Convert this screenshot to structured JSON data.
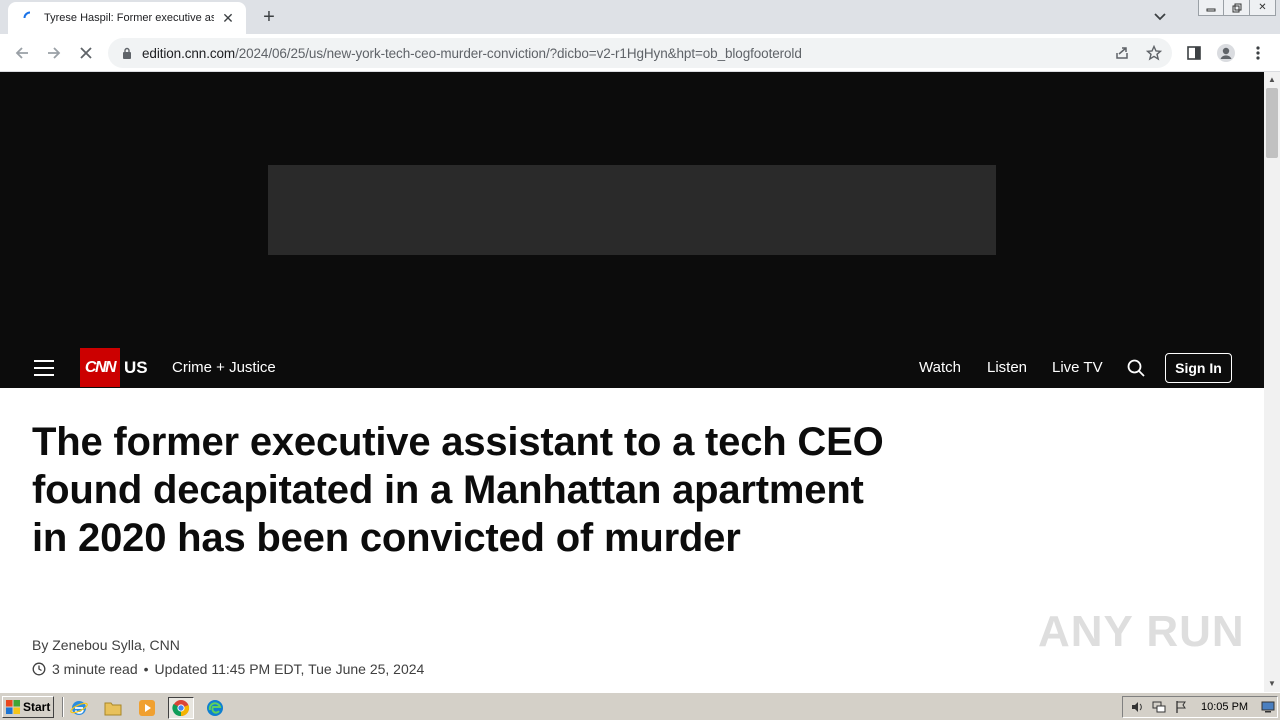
{
  "browser": {
    "tab_title": "Tyrese Haspil: Former executive assistant to a tech CEO",
    "url_host": "edition.cnn.com",
    "url_path": "/2024/06/25/us/new-york-tech-ceo-murder-conviction/?dicbo=v2-r1HgHyn&hpt=ob_blogfooterold"
  },
  "cnn_nav": {
    "logo": "CNN",
    "section": "US",
    "subsection": "Crime + Justice",
    "watch": "Watch",
    "listen": "Listen",
    "live_tv": "Live TV",
    "sign_in": "Sign In"
  },
  "article": {
    "headline": "The former executive assistant to a tech CEO found decapitated in a Manhattan apartment in 2020 has been convicted of murder",
    "byline": "By Zenebou Sylla, CNN",
    "read_time": "3 minute read",
    "updated": "Updated 11:45 PM EDT, Tue June 25, 2024"
  },
  "watermark": "ANY RUN",
  "taskbar": {
    "start_label": "Start",
    "clock": "10:05 PM"
  },
  "colors": {
    "cnn_red": "#cc0000",
    "nav_black": "#0c0c0c"
  }
}
